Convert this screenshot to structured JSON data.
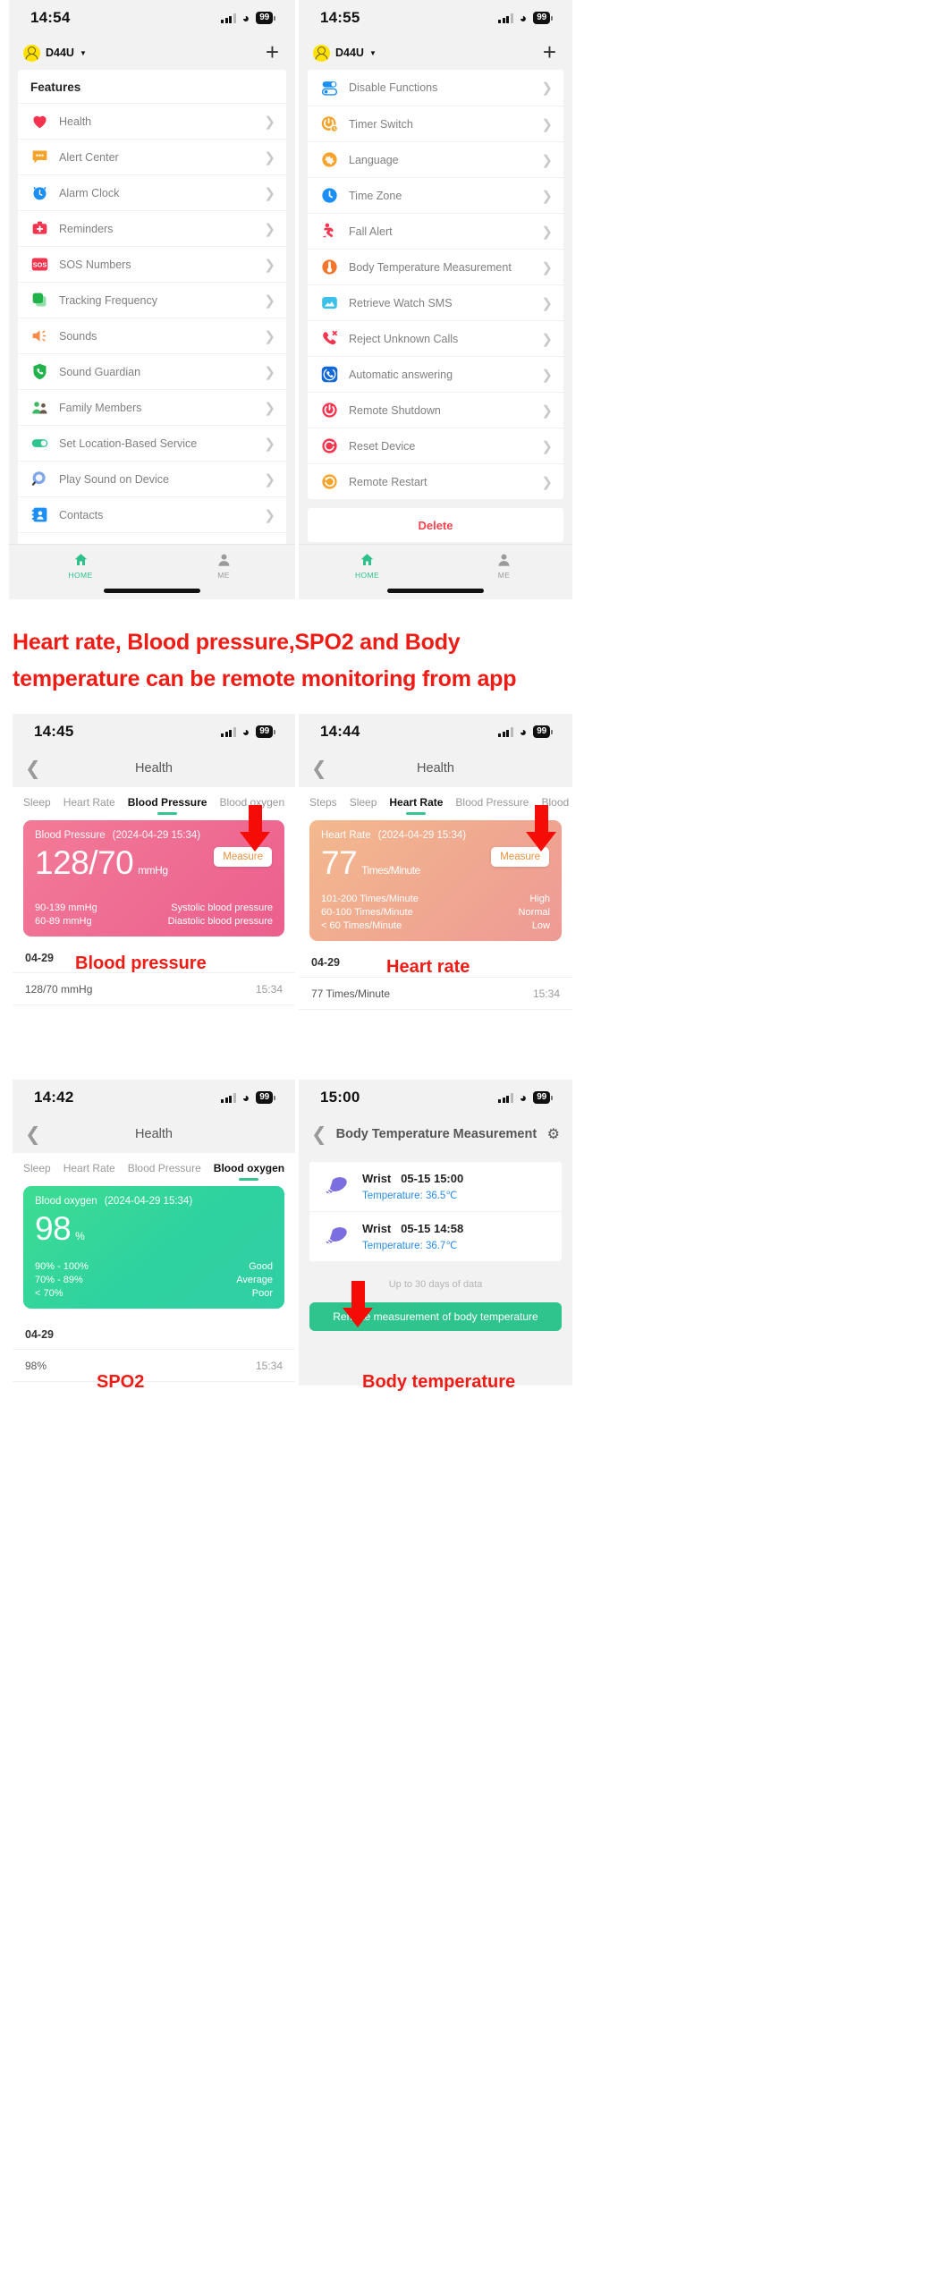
{
  "panels": {
    "home_features": {
      "status": {
        "time": "14:54",
        "battery": "99",
        "signal_icon": "cellular-signal-icon",
        "wifi_icon": "wifi-icon"
      },
      "header": {
        "device_name": "D44U",
        "add_label": "+",
        "avatar_icon": "device-avatar-icon",
        "caret_icon": "chevron-down-icon"
      },
      "section_title": "Features",
      "items": [
        {
          "label": "Health",
          "icon": "heart-icon"
        },
        {
          "label": "Alert Center",
          "icon": "alert-message-icon"
        },
        {
          "label": "Alarm Clock",
          "icon": "alarm-clock-icon"
        },
        {
          "label": "Reminders",
          "icon": "medical-kit-icon"
        },
        {
          "label": "SOS Numbers",
          "icon": "sos-icon"
        },
        {
          "label": "Tracking Frequency",
          "icon": "layers-icon"
        },
        {
          "label": "Sounds",
          "icon": "speaker-icon"
        },
        {
          "label": "Sound Guardian",
          "icon": "phone-shield-icon"
        },
        {
          "label": "Family Members",
          "icon": "family-members-icon"
        },
        {
          "label": "Set Location-Based Service",
          "icon": "toggle-on-icon"
        },
        {
          "label": "Play Sound on Device",
          "icon": "find-device-icon"
        },
        {
          "label": "Contacts",
          "icon": "contacts-icon"
        }
      ],
      "tabbar": {
        "home": "HOME",
        "me": "ME"
      }
    },
    "home_features_2": {
      "status": {
        "time": "14:55",
        "battery": "99"
      },
      "header": {
        "device_name": "D44U",
        "add_label": "+"
      },
      "items": [
        {
          "label": "Disable Functions",
          "icon": "toggles-icon"
        },
        {
          "label": "Timer Switch",
          "icon": "power-timer-icon"
        },
        {
          "label": "Language",
          "icon": "globe-icon"
        },
        {
          "label": "Time Zone",
          "icon": "clock-icon"
        },
        {
          "label": "Fall Alert",
          "icon": "fall-alert-icon"
        },
        {
          "label": "Body Temperature Measurement",
          "icon": "thermometer-icon"
        },
        {
          "label": "Retrieve Watch SMS",
          "icon": "sms-icon"
        },
        {
          "label": "Reject Unknown Calls",
          "icon": "reject-call-icon"
        },
        {
          "label": "Automatic answering",
          "icon": "auto-answer-icon"
        },
        {
          "label": "Remote Shutdown",
          "icon": "power-off-icon"
        },
        {
          "label": "Reset Device",
          "icon": "reset-icon"
        },
        {
          "label": "Remote Restart",
          "icon": "restart-icon"
        }
      ],
      "delete_label": "Delete",
      "tabbar": {
        "home": "HOME",
        "me": "ME"
      }
    },
    "blood_pressure": {
      "status": {
        "time": "14:45",
        "battery": "99"
      },
      "nav_title": "Health",
      "tabs": [
        "Sleep",
        "Heart Rate",
        "Blood Pressure",
        "Blood oxygen"
      ],
      "active_tab": "Blood Pressure",
      "card": {
        "title": "Blood Pressure",
        "timestamp": "(2024-04-29 15:34)",
        "value": "128/70",
        "unit": "mmHg",
        "measure_label": "Measure",
        "ranges": [
          {
            "range": "90-139 mmHg",
            "desc": "Systolic blood pressure"
          },
          {
            "range": "60-89 mmHg",
            "desc": "Diastolic blood pressure"
          }
        ]
      },
      "day": "04-29",
      "history": [
        {
          "value": "128/70 mmHg",
          "time": "15:34"
        }
      ]
    },
    "heart_rate": {
      "status": {
        "time": "14:44",
        "battery": "99"
      },
      "nav_title": "Health",
      "tabs": [
        "Steps",
        "Sleep",
        "Heart Rate",
        "Blood Pressure",
        "Blood o"
      ],
      "active_tab": "Heart Rate",
      "card": {
        "title": "Heart Rate",
        "timestamp": "(2024-04-29 15:34)",
        "value": "77",
        "unit": "Times/Minute",
        "measure_label": "Measure",
        "ranges": [
          {
            "range": "101-200 Times/Minute",
            "desc": "High"
          },
          {
            "range": "60-100 Times/Minute",
            "desc": "Normal"
          },
          {
            "range": "< 60 Times/Minute",
            "desc": "Low"
          }
        ]
      },
      "day": "04-29",
      "history": [
        {
          "value": "77 Times/Minute",
          "time": "15:34"
        }
      ]
    },
    "blood_oxygen": {
      "status": {
        "time": "14:42",
        "battery": "99"
      },
      "nav_title": "Health",
      "tabs": [
        "Sleep",
        "Heart Rate",
        "Blood Pressure",
        "Blood oxygen"
      ],
      "active_tab": "Blood oxygen",
      "card": {
        "title": "Blood oxygen",
        "timestamp": "(2024-04-29 15:34)",
        "value": "98",
        "unit": "%",
        "ranges": [
          {
            "range": "90% - 100%",
            "desc": "Good"
          },
          {
            "range": "70% - 89%",
            "desc": "Average"
          },
          {
            "range": "< 70%",
            "desc": "Poor"
          }
        ]
      },
      "day": "04-29",
      "history": [
        {
          "value": "98%",
          "time": "15:34"
        }
      ]
    },
    "body_temperature": {
      "status": {
        "time": "15:00",
        "battery": "99"
      },
      "nav_title": "Body Temperature Measurement",
      "gear_icon": "gear-icon",
      "items": [
        {
          "place": "Wrist",
          "datetime": "05-15 15:00",
          "temp": "Temperature: 36.5℃",
          "icon": "wrist-sensor-icon"
        },
        {
          "place": "Wrist",
          "datetime": "05-15 14:58",
          "temp": "Temperature: 36.7℃",
          "icon": "wrist-sensor-icon"
        }
      ],
      "footer_note": "Up to 30 days of data",
      "action_label": "Remote measurement of body temperature"
    }
  },
  "annotations": {
    "banner_line1": "Heart rate, Blood pressure,SPO2 and Body",
    "banner_line2": "temperature can be remote monitoring from app",
    "caption_bp": "Blood pressure",
    "caption_hr": "Heart rate",
    "caption_spo2": "SPO2",
    "caption_temp": "Body temperature",
    "arrow_icon": "down-arrow-annotation"
  },
  "colors": {
    "accent_green": "#2fc48e",
    "annotation_red": "#ef1b15",
    "bp_pink": "#ec5f8e",
    "hr_orange": "#f0a990",
    "spo2_green": "#31cfa4",
    "link_blue": "#2a8ce8"
  }
}
